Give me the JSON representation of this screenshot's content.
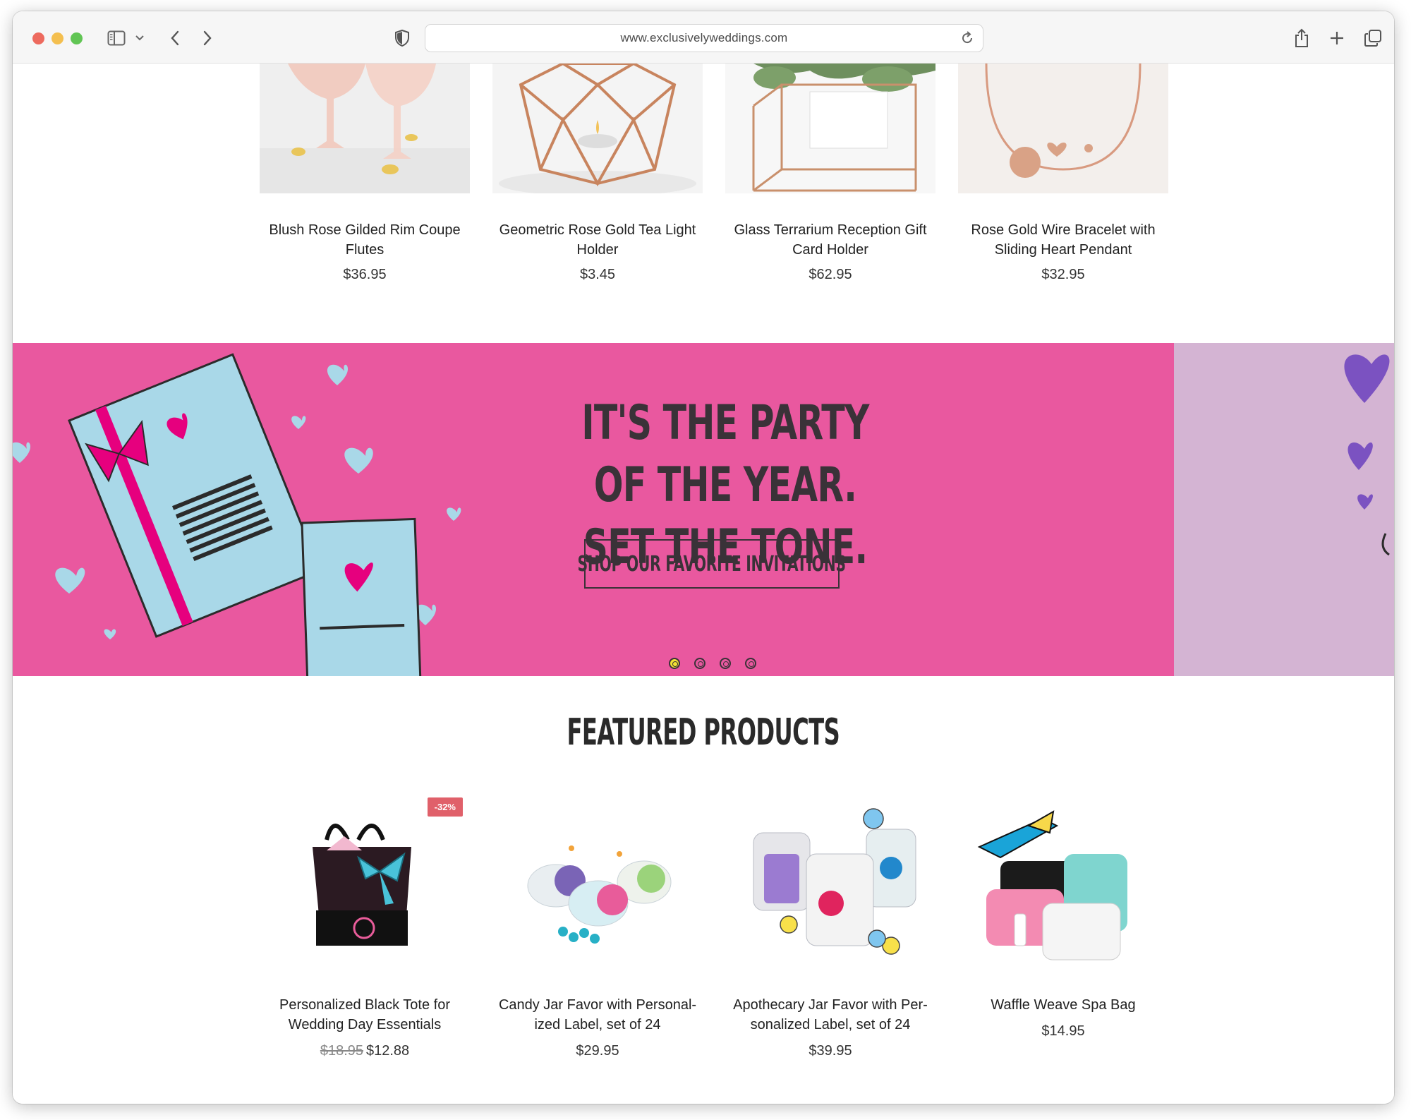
{
  "browser": {
    "url": "www.exclusivelyweddings.com"
  },
  "top_products": [
    {
      "title": "Blush Rose Gilded Rim Coupe Flutes",
      "price": "$36.95",
      "image": "coupe-flutes-image"
    },
    {
      "title": "Geometric Rose Gold Tea Light Holder",
      "price": "$3.45",
      "image": "tea-light-holder-image"
    },
    {
      "title": "Glass Terrarium Reception Gift Card Holder",
      "price": "$62.95",
      "image": "terrarium-card-holder-image"
    },
    {
      "title": "Rose Gold Wire Bracelet with Sliding Heart Pendant",
      "price": "$32.95",
      "image": "bracelet-image"
    }
  ],
  "banner": {
    "headline_line1": "It's the party of the year.",
    "headline_line2": "Set the tone.",
    "cta": "Shop our favorite invitations",
    "slide_count": 4,
    "active_slide": 1,
    "colors": {
      "pink": "#e9589f",
      "lilac": "#d4b4d3",
      "light_blue": "#a9d8e8",
      "heart_pink": "#e6007e",
      "purple_heart": "#7b52c1"
    }
  },
  "featured": {
    "title": "Featured Products",
    "products": [
      {
        "title_line1": "Personalized Black Tote for",
        "title_line2": "Wedding Day Essentials",
        "old_price": "$18.95",
        "price": "$12.88",
        "badge": "-32%"
      },
      {
        "title_line1": "Candy Jar Favor with Personal-",
        "title_line2": "ized Label, set of 24",
        "price": "$29.95"
      },
      {
        "title_line1": "Apothecary Jar Favor with Per-",
        "title_line2": "sonalized Label, set of 24",
        "price": "$39.95"
      },
      {
        "title_line1": "Waffle Weave Spa Bag",
        "title_line2": "",
        "price": "$14.95"
      }
    ]
  }
}
